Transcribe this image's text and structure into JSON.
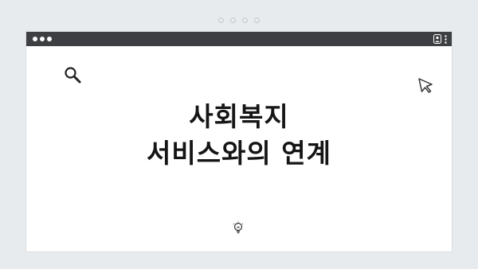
{
  "slide": {
    "title_line1": "사회복지",
    "title_line2": "서비스와의 연계"
  },
  "pager": {
    "dot_count": 4,
    "active_index": -1
  },
  "window": {
    "titlebar_color": "#3d3f42",
    "icons": [
      "user-icon",
      "kebab-menu-icon"
    ]
  },
  "decor": {
    "icons": [
      "search-icon",
      "cursor-icon",
      "lightbulb-icon"
    ]
  }
}
